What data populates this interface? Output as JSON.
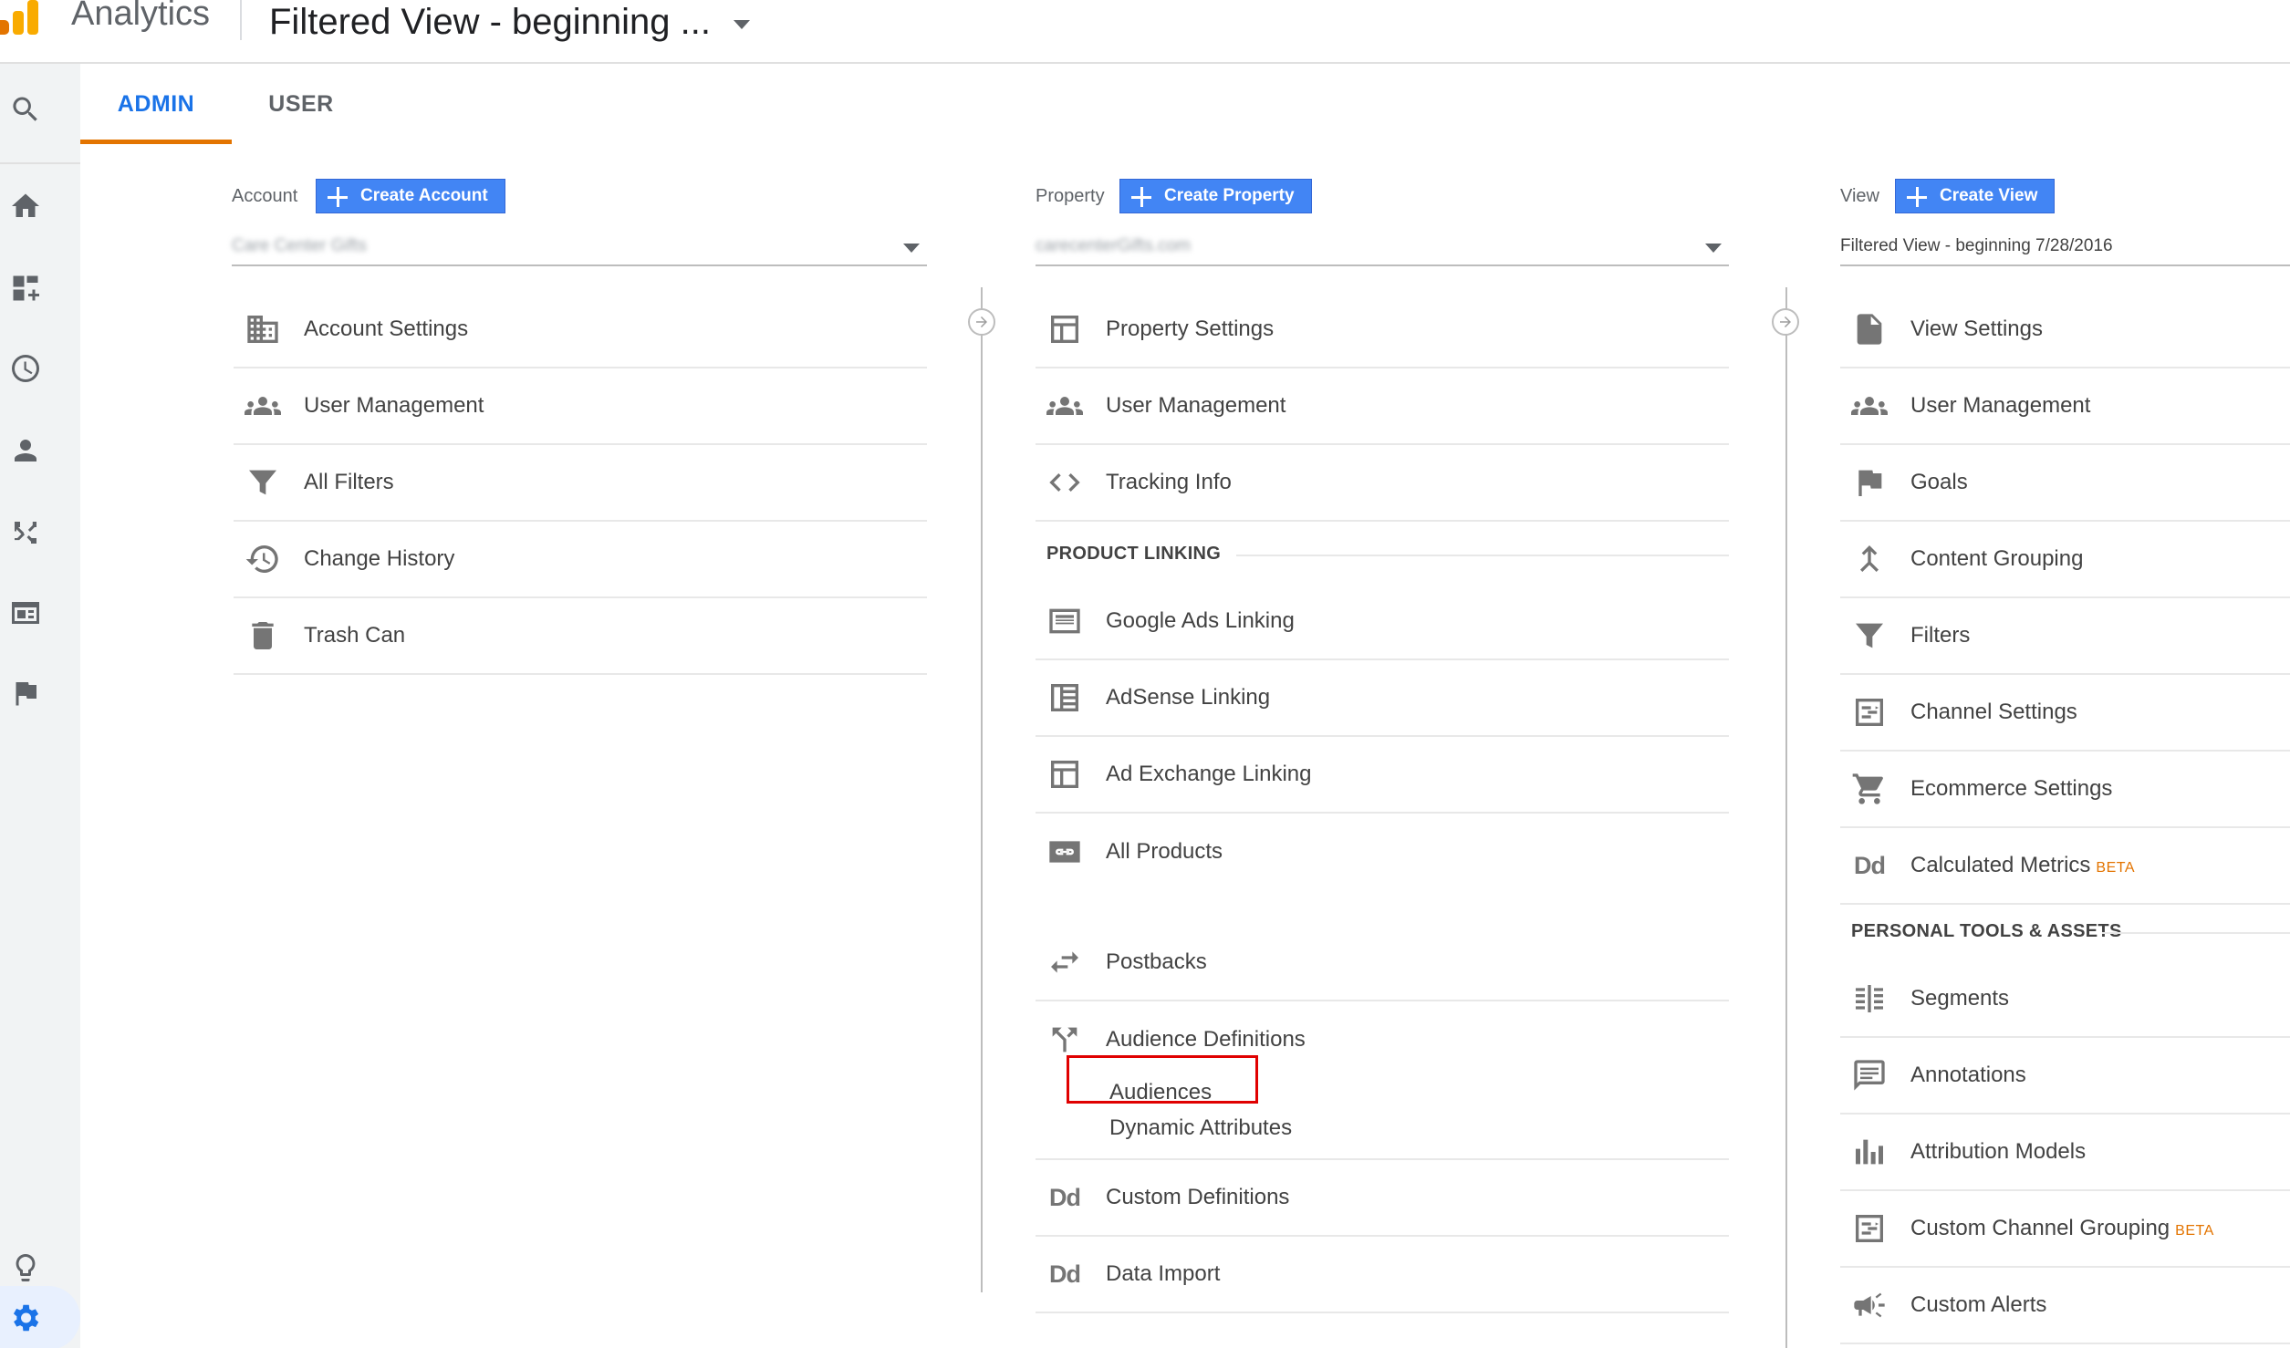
{
  "app": {
    "name": "Analytics",
    "current_view": "Filtered View - beginning ..."
  },
  "tabs": [
    {
      "label": "ADMIN",
      "active": true
    },
    {
      "label": "USER",
      "active": false
    }
  ],
  "rail": [
    "search-icon",
    "home-icon",
    "customization-icon",
    "realtime-icon",
    "audience-icon",
    "acquisition-icon",
    "behavior-icon",
    "conversions-icon",
    "discover-icon",
    "admin-gear-icon"
  ],
  "account": {
    "label": "Account",
    "create_label": "Create Account",
    "selected": "Care Center Gifts",
    "items": [
      {
        "label": "Account Settings",
        "icon": "building-icon"
      },
      {
        "label": "User Management",
        "icon": "people-icon"
      },
      {
        "label": "All Filters",
        "icon": "filter-icon"
      },
      {
        "label": "Change History",
        "icon": "history-icon"
      },
      {
        "label": "Trash Can",
        "icon": "trash-icon"
      }
    ]
  },
  "property": {
    "label": "Property",
    "create_label": "Create Property",
    "selected": "carecenterGifts.com",
    "items": [
      {
        "label": "Property Settings",
        "icon": "layout-icon"
      },
      {
        "label": "User Management",
        "icon": "people-icon"
      },
      {
        "label": "Tracking Info",
        "icon": "code-icon"
      }
    ],
    "section_title": "PRODUCT LINKING",
    "linking": [
      {
        "label": "Google Ads Linking",
        "icon": "ads-icon"
      },
      {
        "label": "AdSense Linking",
        "icon": "adsense-icon"
      },
      {
        "label": "Ad Exchange Linking",
        "icon": "adexchange-icon"
      },
      {
        "label": "All Products",
        "icon": "link-icon"
      }
    ],
    "more": [
      {
        "label": "Postbacks",
        "icon": "swap-icon"
      },
      {
        "label": "Audience Definitions",
        "icon": "fork-icon"
      }
    ],
    "sub_items": [
      "Audiences",
      "Dynamic Attributes"
    ],
    "tail": [
      {
        "label": "Custom Definitions",
        "icon": "dd-icon"
      },
      {
        "label": "Data Import",
        "icon": "dd-icon"
      }
    ]
  },
  "view": {
    "label": "View",
    "create_label": "Create View",
    "selected": "Filtered View - beginning 7/28/2016",
    "items": [
      {
        "label": "View Settings",
        "icon": "document-icon"
      },
      {
        "label": "User Management",
        "icon": "people-icon"
      },
      {
        "label": "Goals",
        "icon": "flag-icon"
      },
      {
        "label": "Content Grouping",
        "icon": "grouping-icon"
      },
      {
        "label": "Filters",
        "icon": "filter-icon"
      },
      {
        "label": "Channel Settings",
        "icon": "channel-icon"
      },
      {
        "label": "Ecommerce Settings",
        "icon": "cart-icon"
      },
      {
        "label": "Calculated Metrics",
        "icon": "dd-icon",
        "badge": "BETA"
      }
    ],
    "section_title": "PERSONAL TOOLS & ASSETS",
    "tools": [
      {
        "label": "Segments",
        "icon": "segments-icon"
      },
      {
        "label": "Annotations",
        "icon": "annotation-icon"
      },
      {
        "label": "Attribution Models",
        "icon": "bars-icon"
      },
      {
        "label": "Custom Channel Grouping",
        "icon": "channel-icon",
        "badge": "BETA"
      },
      {
        "label": "Custom Alerts",
        "icon": "megaphone-icon"
      }
    ]
  },
  "dd_text": "Dd",
  "colors": {
    "accent": "#1a73e8",
    "tab_underline": "#e37400",
    "button": "#4285f4",
    "highlight": "#e00000",
    "beta": "#e37400"
  }
}
